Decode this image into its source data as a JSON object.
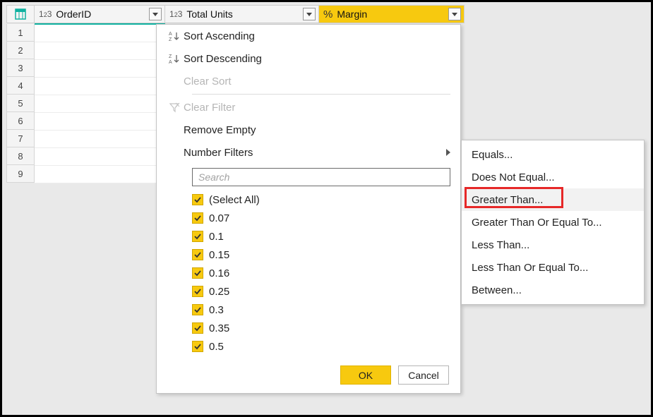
{
  "columns": [
    {
      "typeLabel": "123",
      "name": "OrderID"
    },
    {
      "typeLabel": "123",
      "name": "Total Units"
    },
    {
      "typeLabel": "%",
      "name": "Margin",
      "active": true
    }
  ],
  "rowNumbers": [
    "1",
    "2",
    "3",
    "4",
    "5",
    "6",
    "7",
    "8",
    "9"
  ],
  "filterMenu": {
    "sortAsc": "Sort Ascending",
    "sortDesc": "Sort Descending",
    "clearSort": "Clear Sort",
    "clearFilter": "Clear Filter",
    "removeEmpty": "Remove Empty",
    "numberFilters": "Number Filters",
    "searchPlaceholder": "Search",
    "selectAll": "(Select All)",
    "values": [
      "0.07",
      "0.1",
      "0.15",
      "0.16",
      "0.25",
      "0.3",
      "0.35",
      "0.5"
    ],
    "ok": "OK",
    "cancel": "Cancel"
  },
  "numberFilterSubmenu": {
    "equals": "Equals...",
    "notEqual": "Does Not Equal...",
    "greaterThan": "Greater Than...",
    "greaterEq": "Greater Than Or Equal To...",
    "lessThan": "Less Than...",
    "lessEq": "Less Than Or Equal To...",
    "between": "Between..."
  }
}
